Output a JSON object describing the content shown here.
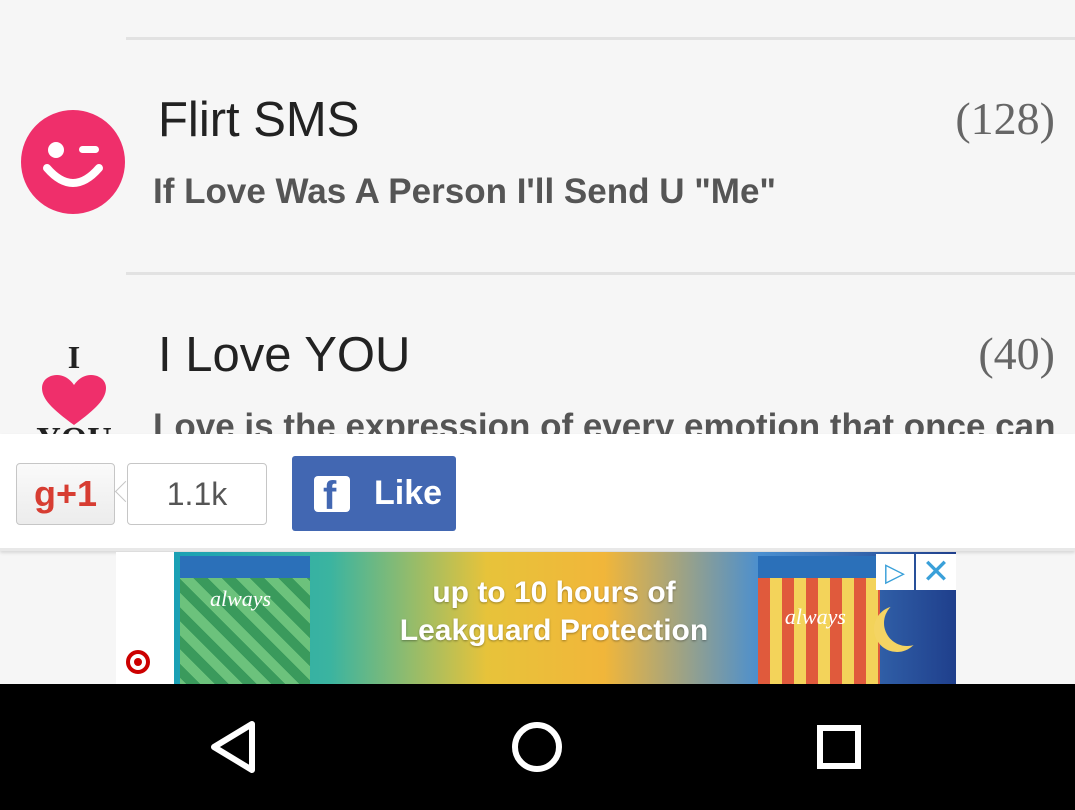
{
  "list": {
    "items": [
      {
        "icon": "winking-face-icon",
        "title": "Flirt SMS",
        "count": "(128)",
        "subtitle": "If Love Was A Person I'll Send U \"Me\""
      },
      {
        "icon": "i-love-you-heart-icon",
        "icon_top_text": "I",
        "icon_bottom_text": "YOU",
        "title": "I Love YOU",
        "count": "(40)",
        "subtitle": "Love is the expression of every emotion that once can"
      }
    ]
  },
  "social": {
    "gplus_label": "g+1",
    "gplus_count": "1.1k",
    "facebook_icon": "facebook-f-icon",
    "facebook_label": "Like"
  },
  "ad": {
    "headline_line1": "up to 10 hours of",
    "headline_line2": "Leakguard Protection",
    "brand_text": "always",
    "adchoices_icon": "adchoices-icon",
    "close_icon": "close-icon",
    "advertiser_icon": "target-logo-icon"
  },
  "navbar": {
    "back_icon": "back-triangle-icon",
    "home_icon": "home-circle-icon",
    "recents_icon": "recents-square-icon"
  },
  "colors": {
    "accent_pink": "#ef2f6b",
    "facebook_blue": "#4267b2",
    "google_red": "#d73d32",
    "background": "#f6f6f6"
  }
}
